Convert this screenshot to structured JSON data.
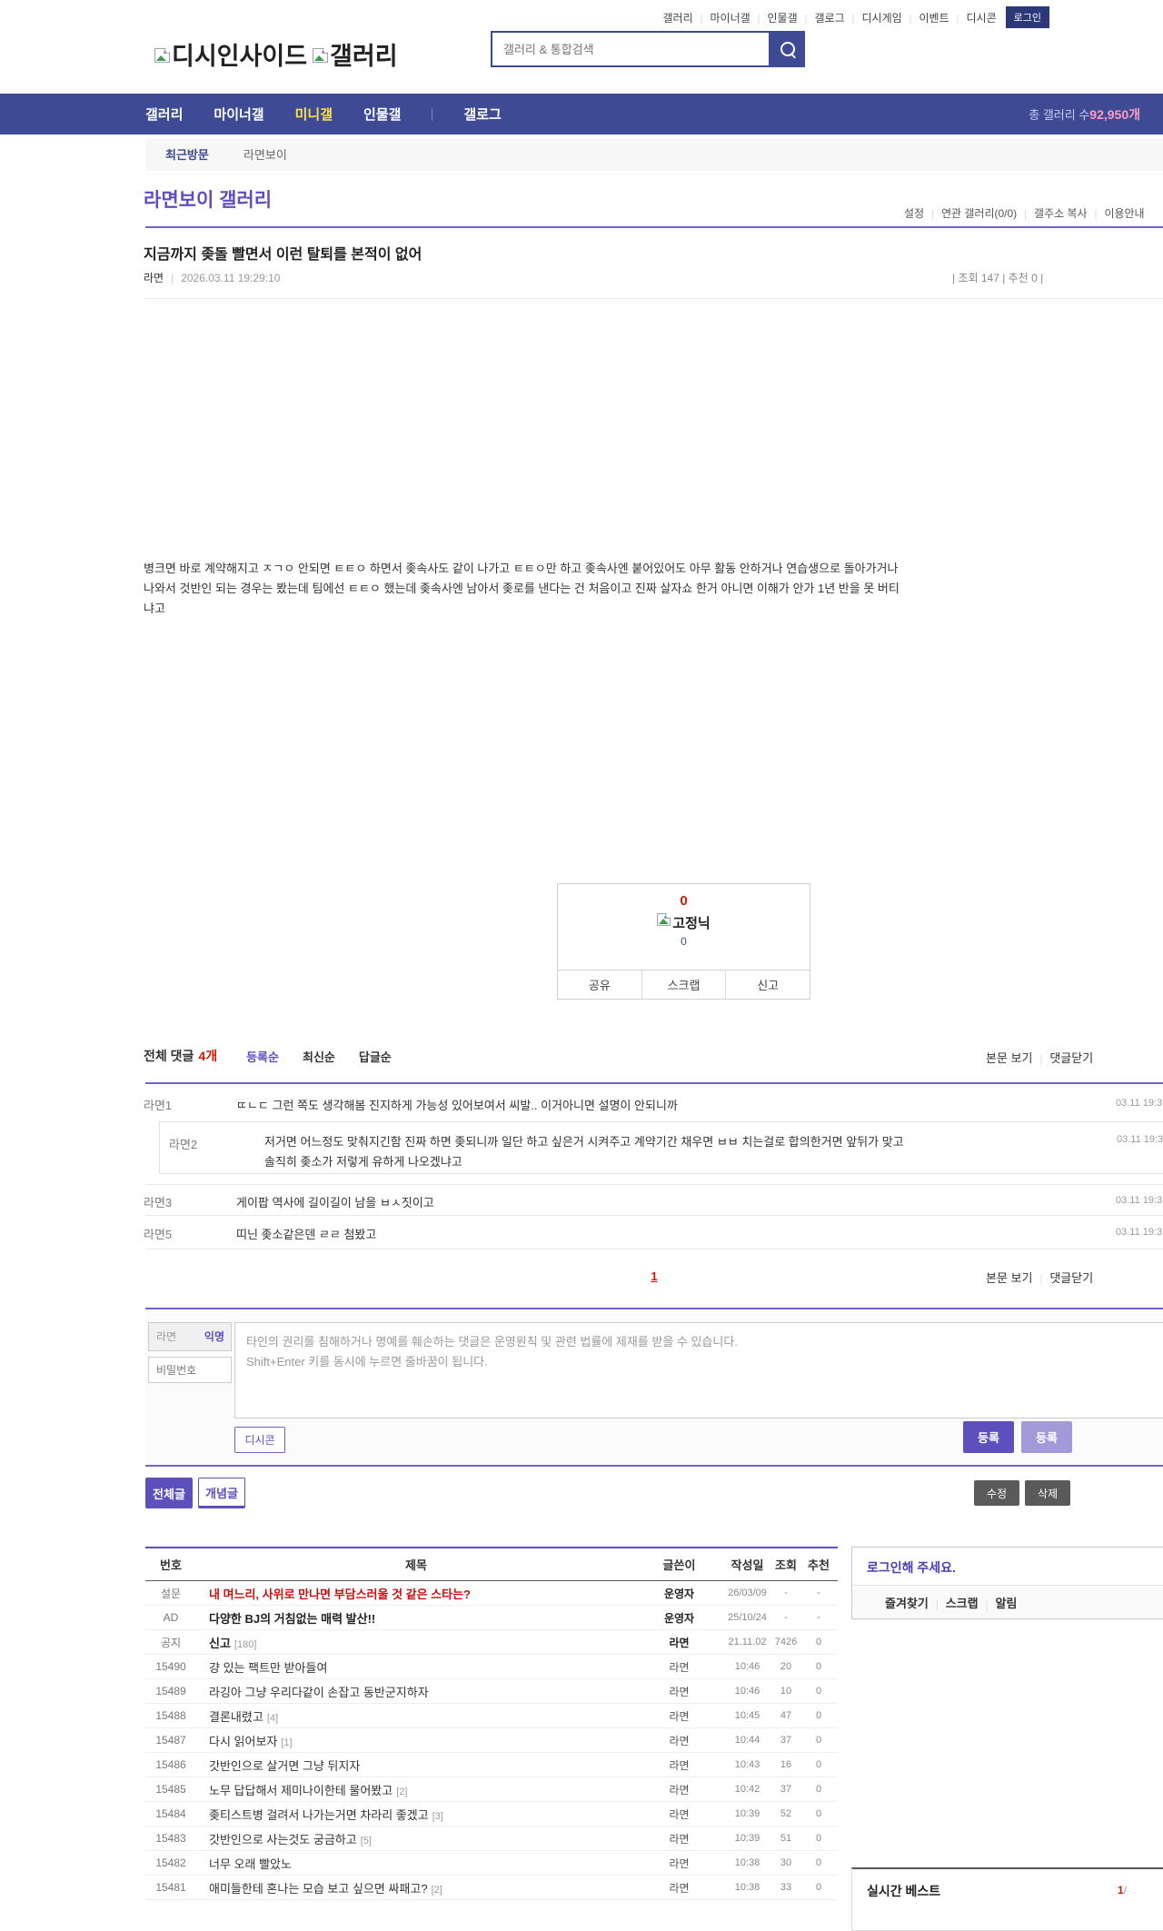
{
  "topbar": {
    "links": [
      "갤러리",
      "마이너갤",
      "인물갤",
      "갤로그",
      "디시게임",
      "이벤트",
      "디시콘"
    ],
    "login": "로그인"
  },
  "logo": {
    "site": "디시인사이드",
    "section": "갤러리"
  },
  "search": {
    "placeholder": "갤러리 & 통합검색"
  },
  "nav": {
    "items": [
      "갤러리",
      "마이너갤",
      "미니갤",
      "인물갤",
      "갤로그"
    ],
    "active": "미니갤",
    "total_label": "총 갤러리 수 ",
    "total_value": "92,950개",
    "accent_active": "#ffe24c",
    "accent_count": "#ff9cc0"
  },
  "breadcrumb": {
    "recent": "최근방문",
    "gallery": "라면보이"
  },
  "gallery": {
    "title": "라면보이 갤러리",
    "links": [
      "설정",
      "연관 갤러리(0/0)",
      "갤주소 복사",
      "이용안내"
    ]
  },
  "post": {
    "title": "지금까지 좆돌 빨면서 이런 탈퇴를 본적이 없어",
    "author": "라면",
    "datetime": "2026.03.11 19:29:10",
    "meta_right": "| 조회 147 | 추천 0 |",
    "views": "147",
    "recommend": "0",
    "body_lines": [
      "병크면 바로 계약해지고 ㅈㄱㅇ 안되면 ㅌㅌㅇ 하면서 좆속사도 같이 나가고 ㅌㅌㅇ만 하고 좆속사엔 붙어있어도 아무 활동 안하거나 연습생으로 돌아가거나",
      "나와서 것반인 되는 경우는 봤는데 팀에선 ㅌㅌㅇ 했는데 좆속사엔 남아서 좆로를 낸다는 건 처음이고 진짜 살자쇼 한거 아니면 이해가 안가 1년 반을 못 버티",
      "냐고"
    ],
    "vote": {
      "up": "0",
      "nick": "고정닉",
      "down": "0",
      "share": "공유",
      "scrap": "스크랩",
      "report": "신고"
    }
  },
  "comments": {
    "total_label": "전체 댓글",
    "count": "4개",
    "sorts": [
      "등록순",
      "최신순",
      "답글순"
    ],
    "active_sort": "등록순",
    "view_post": "본문 보기",
    "close_label": "댓글닫기",
    "page": "1",
    "items": [
      {
        "author": "라면1",
        "text": "ㄸㄴㄷ 그런 쪽도 생각해봄 진지하게 가능성 있어보여서 씨발.. 이거아니면 설명이 안되니까",
        "time": "03.11 19:3"
      },
      {
        "author": "라면2",
        "lines": [
          "저거면 어느정도 맞춰지긴함 진짜 하면 좆되니까 일단 하고 싶은거 시켜주고 계약기간 채우면 ㅂㅂ 치는걸로 합의한거면 앞뒤가 맞고",
          "솔직히 좆소가 저렇게 유하게 나오겠냐고"
        ],
        "time": "03.11 19:3"
      },
      {
        "author": "라면3",
        "text": "게이팝 역사에 길이길이 남을 ㅂㅅ짓이고",
        "time": "03.11 19:3"
      },
      {
        "author": "라면5",
        "text": "띠닌 좆소같은덴 ㄹㄹ 첨봤고",
        "time": "03.11 19:3"
      }
    ]
  },
  "form": {
    "name_value": "라면",
    "anon_label": "익명",
    "password_placeholder": "비밀번호",
    "notice_lines": [
      "타인의 권리를 침해하거나 명예를 훼손하는 댓글은 운영원칙 및 관련 법률에 제재를 받을 수 있습니다.",
      "Shift+Enter 키를 동시에 누르면 줄바꿈이 됩니다."
    ],
    "dccon_label": "디시콘",
    "submit_label": "등록",
    "submit2_label": "등록"
  },
  "actions": {
    "all_posts": "전체글",
    "best_posts": "개념글",
    "edit": "수정",
    "delete": "삭제"
  },
  "board": {
    "headers": [
      "번호",
      "제목",
      "글쓴이",
      "작성일",
      "조회",
      "추천"
    ],
    "rows": [
      {
        "no": "설문",
        "title": "내 며느리, 사위로 만나면 부담스러울 것 같은 스타는?",
        "author": "운영자",
        "date": "26/03/09",
        "views": "-",
        "rec": "-"
      },
      {
        "no": "AD",
        "title": "다양한 BJ의 거침없는 매력 발산!!",
        "author": "운영자",
        "date": "25/10/24",
        "views": "-",
        "rec": "-"
      },
      {
        "no": "공지",
        "title": "신고",
        "count": "[180]",
        "author": "라면",
        "date": "21.11.02",
        "views": "7426",
        "rec": "0"
      },
      {
        "no": "15490",
        "title": "걍 있는 팩트만 받아들여",
        "author": "라면",
        "date": "10:46",
        "views": "20",
        "rec": "0"
      },
      {
        "no": "15489",
        "title": "라깅아 그냥 우리다같이 손잡고 동반군지하자",
        "author": "라면",
        "date": "10:46",
        "views": "10",
        "rec": "0"
      },
      {
        "no": "15488",
        "title": "결론내렸고",
        "count": "[4]",
        "author": "라면",
        "date": "10:45",
        "views": "47",
        "rec": "0"
      },
      {
        "no": "15487",
        "title": "다시 읽어보자",
        "count": "[1]",
        "author": "라면",
        "date": "10:44",
        "views": "37",
        "rec": "0"
      },
      {
        "no": "15486",
        "title": "갓반인으로 살거면 그냥 뒤지자",
        "author": "라면",
        "date": "10:43",
        "views": "16",
        "rec": "0"
      },
      {
        "no": "15485",
        "title": "노무 답답해서 제미나이한테 물어봤고",
        "count": "[2]",
        "author": "라면",
        "date": "10:42",
        "views": "37",
        "rec": "0"
      },
      {
        "no": "15484",
        "title": "좆티스트병 걸려서 나가는거면 차라리 좋겠고",
        "count": "[3]",
        "author": "라면",
        "date": "10:39",
        "views": "52",
        "rec": "0"
      },
      {
        "no": "15483",
        "title": "갓반인으로 사는것도 궁금하고",
        "count": "[5]",
        "author": "라면",
        "date": "10:39",
        "views": "51",
        "rec": "0"
      },
      {
        "no": "15482",
        "title": "너무 오래 빨았노",
        "author": "라면",
        "date": "10:38",
        "views": "30",
        "rec": "0"
      },
      {
        "no": "15481",
        "title": "애미들한테 혼나는 모습 보고 싶으면 싸패고?",
        "count": "[2]",
        "author": "라면",
        "date": "10:38",
        "views": "33",
        "rec": "0"
      }
    ]
  },
  "sidebar": {
    "login_message": "로그인해 주세요.",
    "tabs": [
      "즐겨찾기",
      "스크랩",
      "알림"
    ],
    "best_title": "실시간 베스트",
    "best_page_current": "1",
    "best_page_sep": "/"
  }
}
